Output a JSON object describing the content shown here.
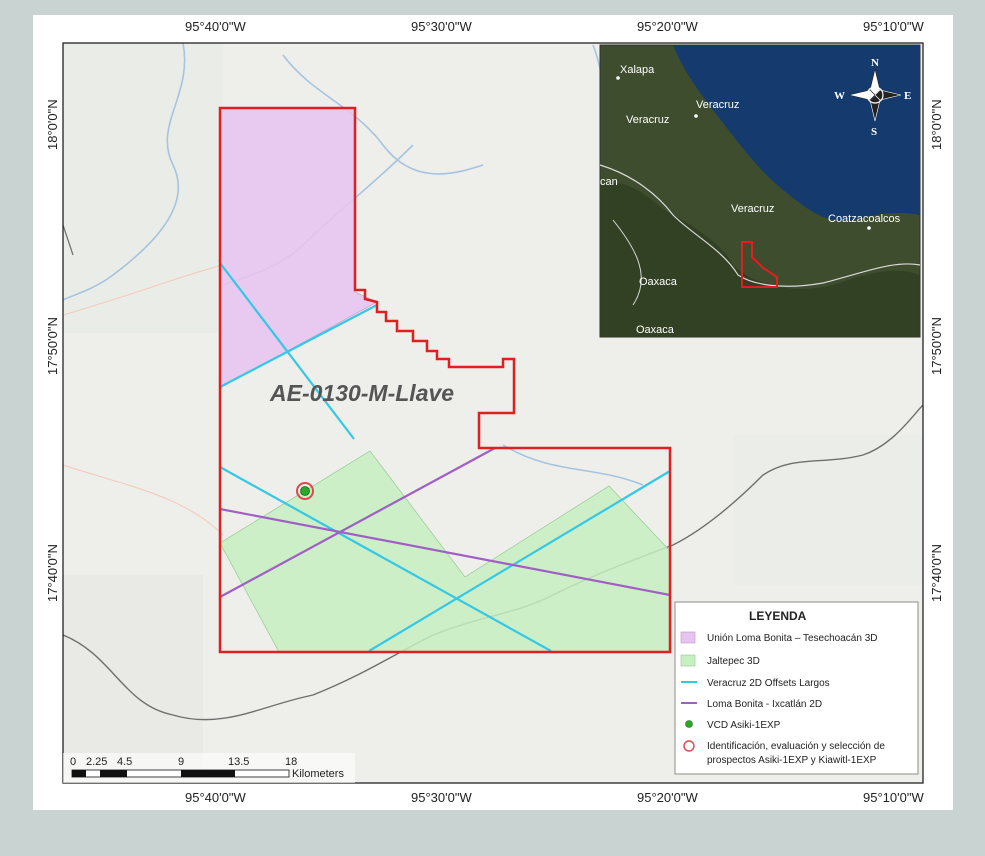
{
  "map": {
    "area_name": "AE-0130-M-Llave",
    "lon_ticks_top": [
      "95°40'0\"W",
      "95°30'0\"W",
      "95°20'0\"W",
      "95°10'0\"W"
    ],
    "lon_ticks_bottom": [
      "95°40'0\"W",
      "95°30'0\"W",
      "95°20'0\"W",
      "95°10'0\"W"
    ],
    "lat_ticks_left": [
      "18°0'0\"N",
      "17°50'0\"N",
      "17°40'0\"N"
    ],
    "lat_ticks_right": [
      "18°0'0\"N",
      "17°50'0\"N",
      "17°40'0\"N"
    ]
  },
  "inset": {
    "labels": [
      "Xalapa",
      "Veracruz",
      "Veracruz",
      "Veracruz",
      "Coatzacoalcos",
      "Oaxaca",
      "Oaxaca",
      "can"
    ],
    "compass": {
      "n": "N",
      "s": "S",
      "e": "E",
      "w": "W"
    }
  },
  "legend": {
    "title": "LEYENDA",
    "items": [
      {
        "label": "Unión Loma Bonita – Tesechoacán 3D",
        "color": "#e7c4ef",
        "kind": "fill"
      },
      {
        "label": "Jaltepec 3D",
        "color": "#c6efc2",
        "kind": "fill"
      },
      {
        "label": "Veracruz 2D Offsets Largos",
        "color": "#33c8e6",
        "kind": "line"
      },
      {
        "label": "Loma Bonita - Ixcatlán 2D",
        "color": "#a05fc4",
        "kind": "line"
      },
      {
        "label": "VCD Asiki-1EXP",
        "color": "#2aa82a",
        "kind": "dot"
      },
      {
        "label": "Identificación, evaluación y selección de",
        "color": "#e0474c",
        "kind": "ring"
      },
      {
        "label": "prospectos Asiki-1EXP y Kiawitl-1EXP",
        "color": "#e0474c",
        "kind": "text"
      }
    ]
  },
  "scale_bar": {
    "ticks": [
      "0",
      "2.25",
      "4.5",
      "9",
      "13.5",
      "18"
    ],
    "unit": "Kilometers"
  },
  "colors": {
    "block_outline": "#e02020",
    "seismic_2d_offsets": "#33c8e6",
    "seismic_2d_loma": "#a05fc4",
    "union_3d": "#e7c4ef",
    "jaltepec_3d": "#c6efc2"
  }
}
